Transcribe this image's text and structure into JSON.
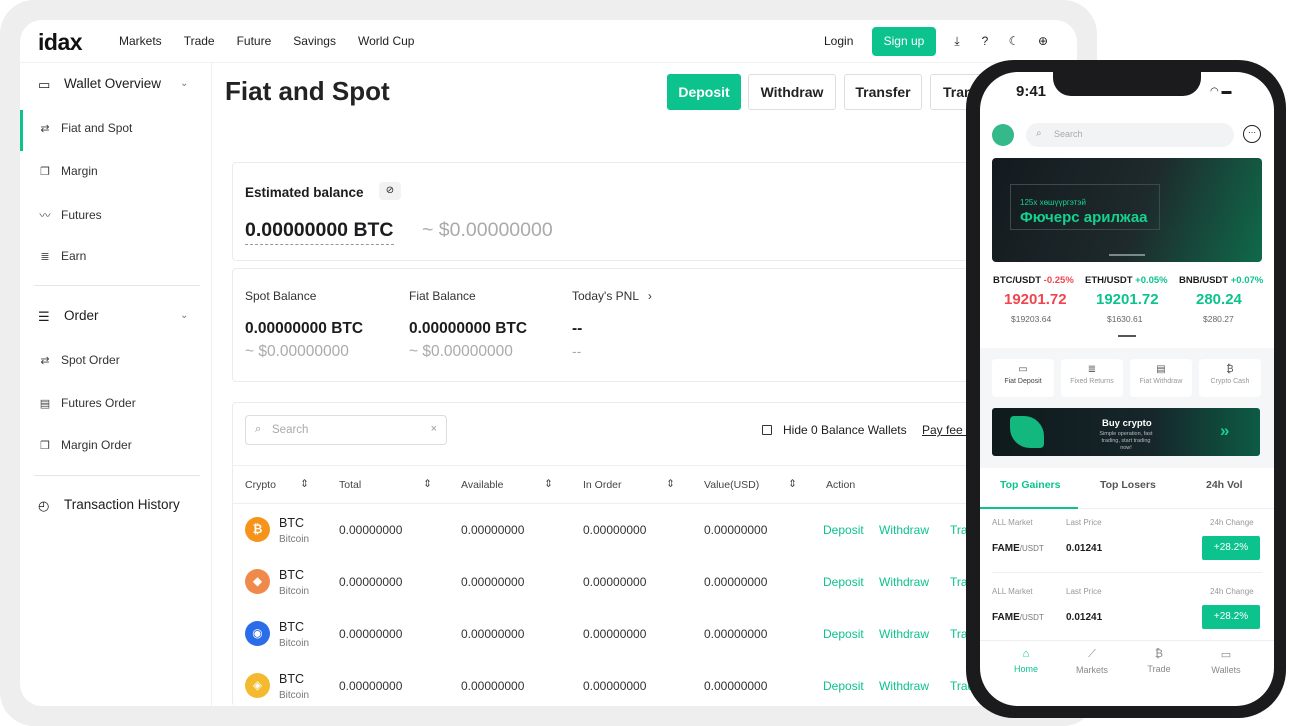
{
  "topbar": {
    "logo": "idax",
    "nav": [
      "Markets",
      "Trade",
      "Future",
      "Savings",
      "World Cup"
    ],
    "login": "Login",
    "signup": "Sign up"
  },
  "sidebar": {
    "wallet_overview": "Wallet Overview",
    "wallet_items": [
      "Fiat and Spot",
      "Margin",
      "Futures",
      "Earn"
    ],
    "order": "Order",
    "order_items": [
      "Spot Order",
      "Futures Order",
      "Margin Order"
    ],
    "history": "Transaction History"
  },
  "main": {
    "title": "Fiat and Spot",
    "buttons": [
      "Deposit",
      "Withdraw",
      "Transfer",
      "Tran"
    ],
    "estimated_label": "Estimated balance",
    "estimated_btc": "0.00000000 BTC",
    "estimated_usd": "~ $0.00000000",
    "spot_label": "Spot Balance",
    "spot_btc": "0.00000000 BTC",
    "spot_usd": "~ $0.00000000",
    "fiat_label": "Fiat Balance",
    "fiat_btc": "0.00000000 BTC",
    "fiat_usd": "~ $0.00000000",
    "pnl_label": "Today's PNL",
    "pnl_value": "--",
    "pnl_sub": "--",
    "search_placeholder": "Search",
    "hide_zero": "Hide 0 Balance Wallets",
    "pay_fee": "Pay fee w",
    "table": {
      "headers": [
        "Crypto",
        "Total",
        "Available",
        "In Order",
        "Value(USD)",
        "Action"
      ],
      "rows": [
        {
          "symbol": "BTC",
          "name": "Bitcoin",
          "total": "0.00000000",
          "available": "0.00000000",
          "in_order": "0.00000000",
          "value": "0.00000000",
          "color": "#f7931a",
          "glyph": "₿"
        },
        {
          "symbol": "BTC",
          "name": "Bitcoin",
          "total": "0.00000000",
          "available": "0.00000000",
          "in_order": "0.00000000",
          "value": "0.00000000",
          "color": "#f08a4b",
          "glyph": "◆"
        },
        {
          "symbol": "BTC",
          "name": "Bitcoin",
          "total": "0.00000000",
          "available": "0.00000000",
          "in_order": "0.00000000",
          "value": "0.00000000",
          "color": "#2b6de8",
          "glyph": "◉"
        },
        {
          "symbol": "BTC",
          "name": "Bitcoin",
          "total": "0.00000000",
          "available": "0.00000000",
          "in_order": "0.00000000",
          "value": "0.00000000",
          "color": "#f3ba2f",
          "glyph": "◈"
        }
      ],
      "actions": [
        "Deposit",
        "Withdraw",
        "Trad"
      ]
    }
  },
  "phone": {
    "time": "9:41",
    "search_placeholder": "Search",
    "banner_small": "125x хөшүүргэтэй",
    "banner_big": "Фючерс арилжаа",
    "tickers": [
      {
        "pair": "BTC/USDT",
        "pct": "-0.25%",
        "price": "19201.72",
        "sub": "$19203.64",
        "up": false
      },
      {
        "pair": "ETH/USDT",
        "pct": "+0.05%",
        "price": "19201.72",
        "sub": "$1630.61",
        "up": true
      },
      {
        "pair": "BNB/USDT",
        "pct": "+0.07%",
        "price": "280.24",
        "sub": "$280.27",
        "up": true
      }
    ],
    "quick": [
      "Fiat Deposit",
      "Fixed Returns",
      "Fiat Withdraw",
      "Crypto Cash"
    ],
    "buy_title": "Buy crypto",
    "buy_sub": "Simple operation, fast trading, start trading now!",
    "tabs": [
      "Top Gainers",
      "Top Losers",
      "24h Vol"
    ],
    "market_headers": [
      "ALL Market",
      "Last Price",
      "24h Change"
    ],
    "market_rows": [
      {
        "base": "FAME",
        "quote": "/USDT",
        "price": "0.01241",
        "change": "+28.2%"
      },
      {
        "base": "FAME",
        "quote": "/USDT",
        "price": "0.01241",
        "change": "+28.2%"
      }
    ],
    "bottom_nav": [
      "Home",
      "Markets",
      "Trade",
      "Wallets"
    ]
  }
}
